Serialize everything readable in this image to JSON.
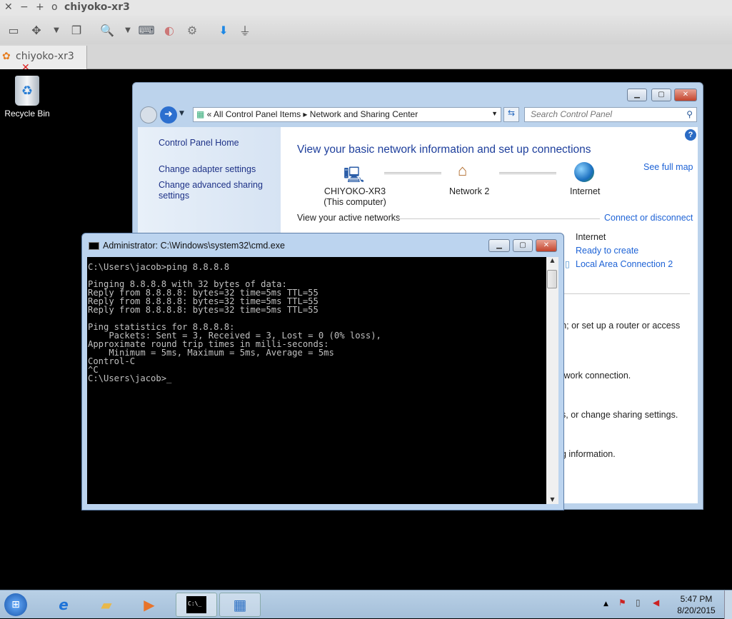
{
  "viewer": {
    "title": "chiyoko-xr3",
    "tab_label": "chiyoko-xr3",
    "toolbar_icons": [
      "window-icon",
      "fullscreen-icon",
      "dropdown-icon",
      "windows-icon",
      "zoom-icon",
      "dropdown-icon",
      "keyboard-icon",
      "toggle-icon",
      "settings-icon",
      "download-icon",
      "plug-icon"
    ]
  },
  "desktop": {
    "recycle_bin": "Recycle Bin"
  },
  "control_panel": {
    "breadcrumb": [
      "All Control Panel Items",
      "Network and Sharing Center"
    ],
    "search_placeholder": "Search Control Panel",
    "sidebar": [
      "Control Panel Home",
      "Change adapter settings",
      "Change advanced sharing settings"
    ],
    "heading": "View your basic network information and set up connections",
    "see_full_map": "See full map",
    "map": {
      "computer": "CHIYOKO-XR3",
      "computer_sub": "(This computer)",
      "network": "Network  2",
      "internet": "Internet"
    },
    "active_networks": "View your active networks",
    "connect_disconnect": "Connect or disconnect",
    "access_type": "Internet",
    "homegroup": "Ready to create",
    "connection": "Local Area Connection 2",
    "fragments": [
      "tion; or set up a router or access",
      "twork connection.",
      "s, or change sharing settings.",
      "g information."
    ]
  },
  "cmd": {
    "title": "Administrator: C:\\Windows\\system32\\cmd.exe",
    "lines": [
      "C:\\Users\\jacob>ping 8.8.8.8",
      "",
      "Pinging 8.8.8.8 with 32 bytes of data:",
      "Reply from 8.8.8.8: bytes=32 time=5ms TTL=55",
      "Reply from 8.8.8.8: bytes=32 time=5ms TTL=55",
      "Reply from 8.8.8.8: bytes=32 time=5ms TTL=55",
      "",
      "Ping statistics for 8.8.8.8:",
      "    Packets: Sent = 3, Received = 3, Lost = 0 (0% loss),",
      "Approximate round trip times in milli-seconds:",
      "    Minimum = 5ms, Maximum = 5ms, Average = 5ms",
      "Control-C",
      "^C",
      "C:\\Users\\jacob>_"
    ]
  },
  "taskbar": {
    "time": "5:47 PM",
    "date": "8/20/2015",
    "cmd_icon_text": "C:\\_"
  }
}
